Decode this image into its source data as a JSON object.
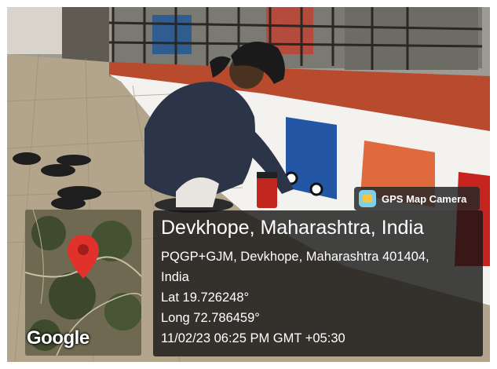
{
  "photo": {
    "description_icons": [
      "woman-painting-icon",
      "painted-wall-icon",
      "sandals-icon",
      "paint-cup-icon"
    ]
  },
  "badge": {
    "icon": "gps-map-camera-icon",
    "label": "GPS Map Camera"
  },
  "map": {
    "pin_icon": "map-pin-icon",
    "logo_text": "Google"
  },
  "info": {
    "title": "Devkhope, Maharashtra, India",
    "address_line1": "PQGP+GJM, Devkhope, Maharashtra 401404,",
    "address_line2": "India",
    "lat": "Lat 19.726248°",
    "long": "Long 72.786459°",
    "datetime": "11/02/23 06:25 PM GMT +05:30"
  },
  "colors": {
    "overlay": "#141414",
    "pin": "#e0312b",
    "badge_bg": "#282828"
  }
}
